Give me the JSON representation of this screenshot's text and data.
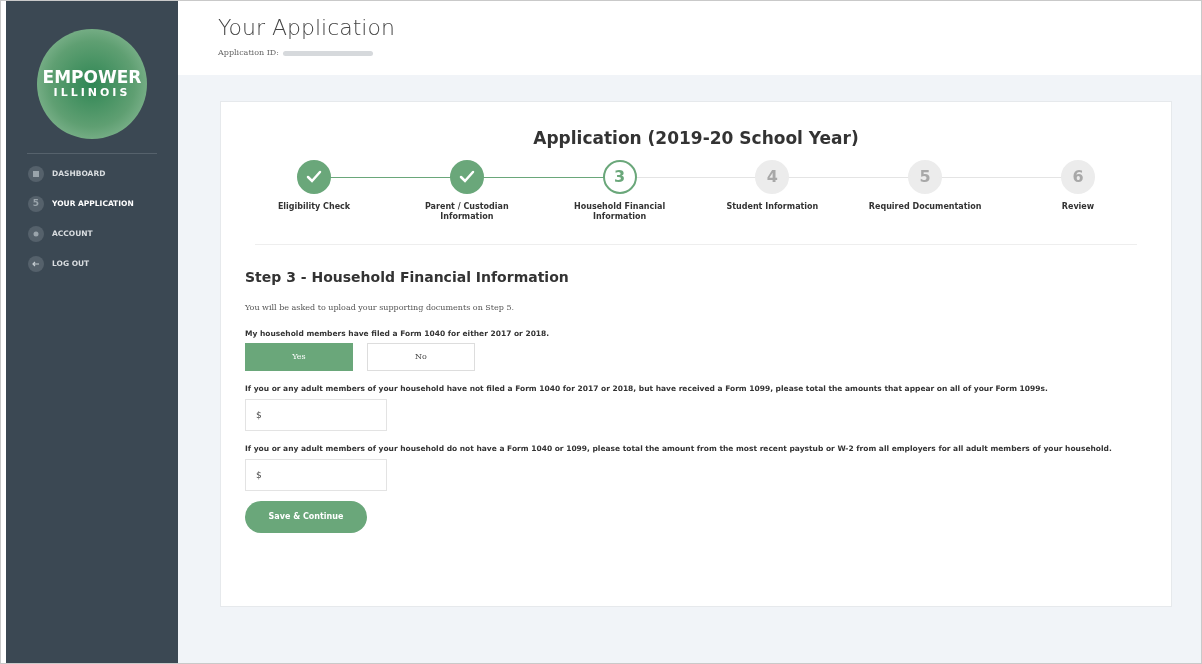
{
  "logo": {
    "line_1": "EMPOWER",
    "line_2": "ILLINOIS"
  },
  "sidebar": {
    "items": [
      {
        "kind": "dashboard",
        "label": "DASHBOARD",
        "selected": false
      },
      {
        "kind": "badge",
        "badge": "5",
        "label": "YOUR APPLICATION",
        "selected": true
      },
      {
        "kind": "account",
        "label": "ACCOUNT",
        "selected": false
      },
      {
        "kind": "logout",
        "label": "LOG OUT",
        "selected": false
      }
    ]
  },
  "header": {
    "title": "Your Application",
    "id_label": "Application ID:"
  },
  "card": {
    "title": "Application (2019-20 School Year)",
    "steps": [
      {
        "label": "Eligibility Check",
        "kind": "done"
      },
      {
        "label": "Parent / Custodian Information",
        "kind": "done"
      },
      {
        "number": "3",
        "label": "Household Financial Information",
        "kind": "current"
      },
      {
        "number": "4",
        "label": "Student Information",
        "kind": "todo"
      },
      {
        "number": "5",
        "label": "Required Documentation",
        "kind": "todo"
      },
      {
        "number": "6",
        "label": "Review",
        "kind": "todo"
      }
    ],
    "section_title": "Step 3 - Household Financial Information",
    "intro": "You will be asked to upload your supporting documents on Step 5.",
    "question_1": "My household members have filed a Form 1040 for either 2017 or 2018.",
    "choices": [
      {
        "label": "Yes",
        "selected": true
      },
      {
        "label": "No",
        "selected": false
      }
    ],
    "question_2": "If you or any adult members of your household have not filed a Form 1040 for 2017 or 2018, but have received a Form 1099, please total the amounts that appear on all of your Form 1099s.",
    "field_2": {
      "placeholder": "$"
    },
    "question_3": "If you or any adult members of your household do not have a Form 1040 or 1099, please total the amount from the most recent paystub or W-2 from all employers for all adult members of your household.",
    "field_3": {
      "placeholder": "$"
    },
    "submit": "Save & Continue"
  }
}
